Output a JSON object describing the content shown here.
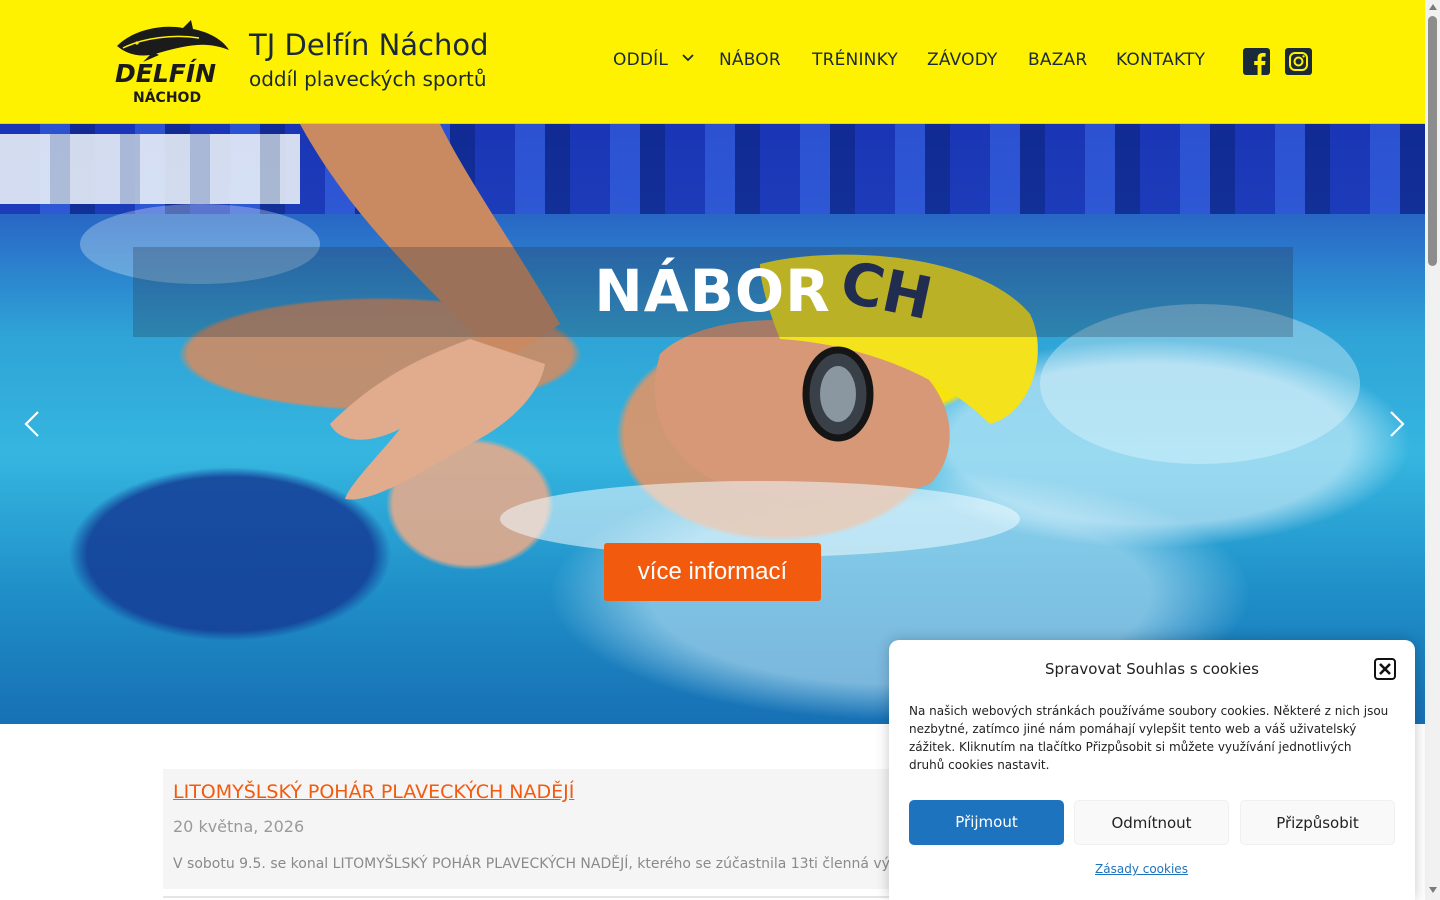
{
  "site": {
    "logo_word": "DELFÍN",
    "logo_sub": "NÁCHOD",
    "title": "TJ Delfín Náchod",
    "subtitle": "oddíl plaveckých sportů"
  },
  "nav": {
    "items": [
      {
        "label": "ODDÍL",
        "has_dropdown": true
      },
      {
        "label": "NÁBOR"
      },
      {
        "label": "TRÉNINKY"
      },
      {
        "label": "ZÁVODY"
      },
      {
        "label": "BAZAR"
      },
      {
        "label": "KONTAKTY"
      }
    ],
    "social": [
      {
        "icon": "facebook-icon"
      },
      {
        "icon": "instagram-icon"
      }
    ]
  },
  "hero": {
    "title": "NÁBOR",
    "button_label": "více informací",
    "cap_text": "CH"
  },
  "post": {
    "title": "LITOMYŠLSKÝ POHÁR PLAVECKÝCH NADĚJÍ",
    "date": "20 května, 2026",
    "excerpt": "V sobotu 9.5. se konal LITOMYŠLSKÝ POHÁR PLAVECKÝCH NADĚJÍ, kterého se zúčastnila 13ti členná výp"
  },
  "cookie": {
    "title": "Spravovat Souhlas s cookies",
    "text": "Na našich webových stránkách používáme soubory cookies. Některé z nich jsou nezbytné, zatímco jiné nám pomáhají vylepšit tento web a váš uživatelský zážitek. Kliknutím na tlačítko Přizpůsobit si můžete využívání jednotlivých druhů cookies nastavit.",
    "accept_label": "Přijmout",
    "deny_label": "Odmítnout",
    "customize_label": "Přizpůsobit",
    "policy_label": "Zásady cookies"
  },
  "colors": {
    "header_bg": "#fff200",
    "accent_orange": "#f25a0e",
    "accept_blue": "#1e73be",
    "text_dark": "#1b2a3a"
  }
}
